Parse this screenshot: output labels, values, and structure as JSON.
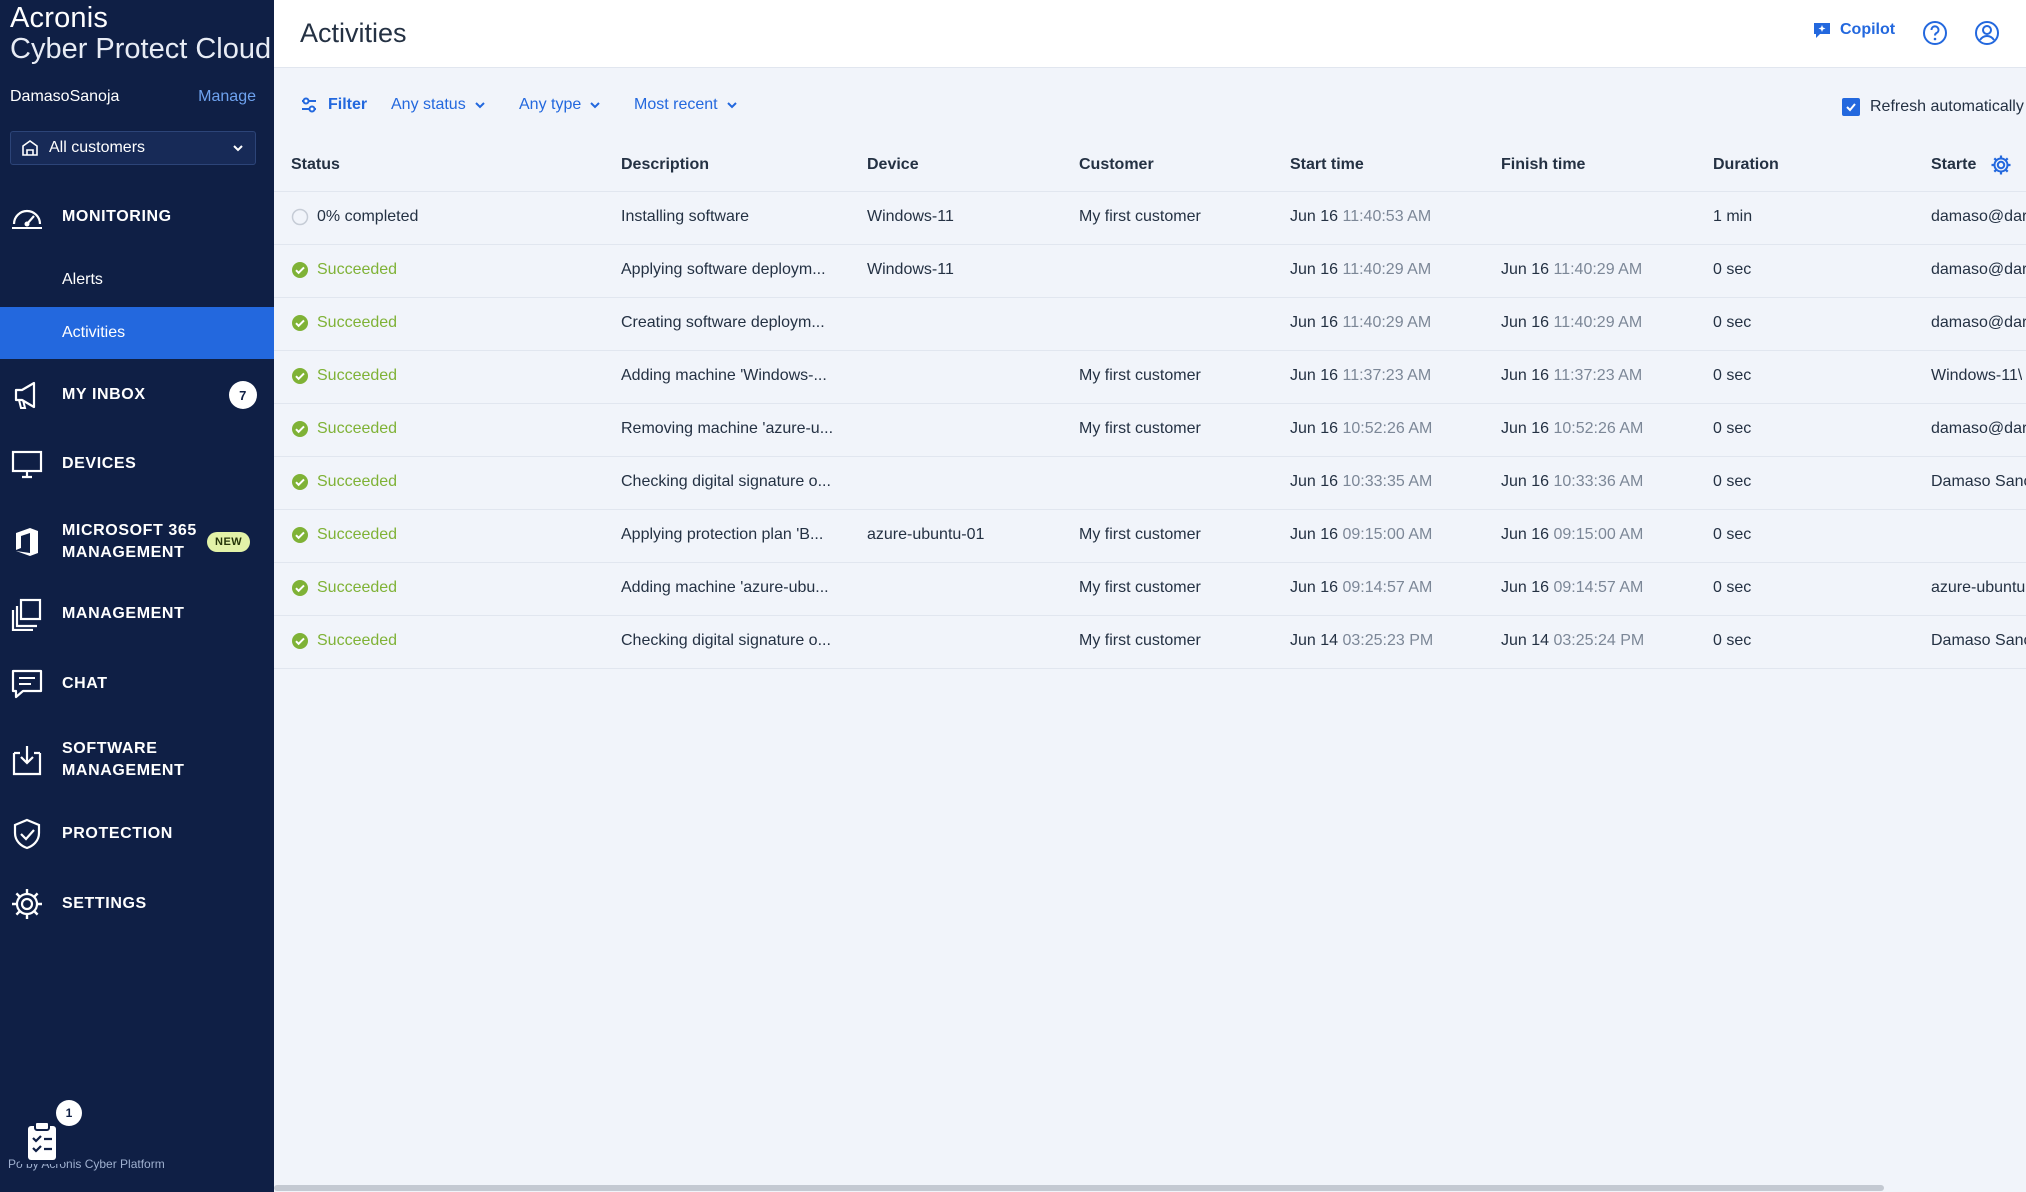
{
  "sidebar": {
    "brand_line1": "Acronis",
    "brand_line2": "Cyber Protect Cloud",
    "user_name": "DamasoSanoja",
    "manage_label": "Manage",
    "customer_select": "All customers",
    "monitoring": "MONITORING",
    "alerts": "Alerts",
    "activities": "Activities",
    "inbox": "MY INBOX",
    "inbox_count": "7",
    "devices": "DEVICES",
    "m365_line1": "MICROSOFT 365",
    "m365_line2": "MANAGEMENT",
    "new_badge": "NEW",
    "management": "MANAGEMENT",
    "chat": "CHAT",
    "software_line1": "SOFTWARE",
    "software_line2": "MANAGEMENT",
    "protection": "PROTECTION",
    "settings": "SETTINGS",
    "task_count": "1",
    "powered_by": "Po    by Acronis Cyber Platform"
  },
  "header": {
    "title": "Activities",
    "copilot": "Copilot"
  },
  "filters": {
    "filter_label": "Filter",
    "status": "Any status",
    "type": "Any type",
    "sort": "Most recent",
    "refresh_label": "Refresh automatically"
  },
  "table": {
    "columns": [
      "Status",
      "Description",
      "Device",
      "Customer",
      "Start time",
      "Finish time",
      "Duration",
      "Starte"
    ],
    "rows": [
      {
        "status": "0% completed",
        "description": "Installing software",
        "device": "Windows-11",
        "customer": "My first customer",
        "start_date": "Jun 16",
        "start_time": "11:40:53 AM",
        "finish_date": "",
        "finish_time": "",
        "duration": "1 min",
        "started_by": "damaso@dar"
      },
      {
        "status": "Succeeded",
        "description": "Applying software deploym...",
        "device": "Windows-11",
        "customer": "",
        "start_date": "Jun 16",
        "start_time": "11:40:29 AM",
        "finish_date": "Jun 16",
        "finish_time": "11:40:29 AM",
        "duration": "0 sec",
        "started_by": "damaso@dar"
      },
      {
        "status": "Succeeded",
        "description": "Creating software deploym...",
        "device": "",
        "customer": "",
        "start_date": "Jun 16",
        "start_time": "11:40:29 AM",
        "finish_date": "Jun 16",
        "finish_time": "11:40:29 AM",
        "duration": "0 sec",
        "started_by": "damaso@dar"
      },
      {
        "status": "Succeeded",
        "description": "Adding machine 'Windows-...",
        "device": "",
        "customer": "My first customer",
        "start_date": "Jun 16",
        "start_time": "11:37:23 AM",
        "finish_date": "Jun 16",
        "finish_time": "11:37:23 AM",
        "duration": "0 sec",
        "started_by": "Windows-11\\"
      },
      {
        "status": "Succeeded",
        "description": "Removing machine 'azure-u...",
        "device": "",
        "customer": "My first customer",
        "start_date": "Jun 16",
        "start_time": "10:52:26 AM",
        "finish_date": "Jun 16",
        "finish_time": "10:52:26 AM",
        "duration": "0 sec",
        "started_by": "damaso@dar"
      },
      {
        "status": "Succeeded",
        "description": "Checking digital signature o...",
        "device": "",
        "customer": "",
        "start_date": "Jun 16",
        "start_time": "10:33:35 AM",
        "finish_date": "Jun 16",
        "finish_time": "10:33:36 AM",
        "duration": "0 sec",
        "started_by": "Damaso Sanc"
      },
      {
        "status": "Succeeded",
        "description": "Applying protection plan 'B...",
        "device": "azure-ubuntu-01",
        "customer": "My first customer",
        "start_date": "Jun 16",
        "start_time": "09:15:00 AM",
        "finish_date": "Jun 16",
        "finish_time": "09:15:00 AM",
        "duration": "0 sec",
        "started_by": ""
      },
      {
        "status": "Succeeded",
        "description": "Adding machine 'azure-ubu...",
        "device": "",
        "customer": "My first customer",
        "start_date": "Jun 16",
        "start_time": "09:14:57 AM",
        "finish_date": "Jun 16",
        "finish_time": "09:14:57 AM",
        "duration": "0 sec",
        "started_by": "azure-ubuntu"
      },
      {
        "status": "Succeeded",
        "description": "Checking digital signature o...",
        "device": "",
        "customer": "My first customer",
        "start_date": "Jun 14",
        "start_time": "03:25:23 PM",
        "finish_date": "Jun 14",
        "finish_time": "03:25:24 PM",
        "duration": "0 sec",
        "started_by": "Damaso Sanc"
      }
    ]
  },
  "colors": {
    "sidebar_bg": "#0f1f45",
    "accent": "#2368de",
    "success": "#7fb236",
    "background": "#f1f4fa"
  }
}
